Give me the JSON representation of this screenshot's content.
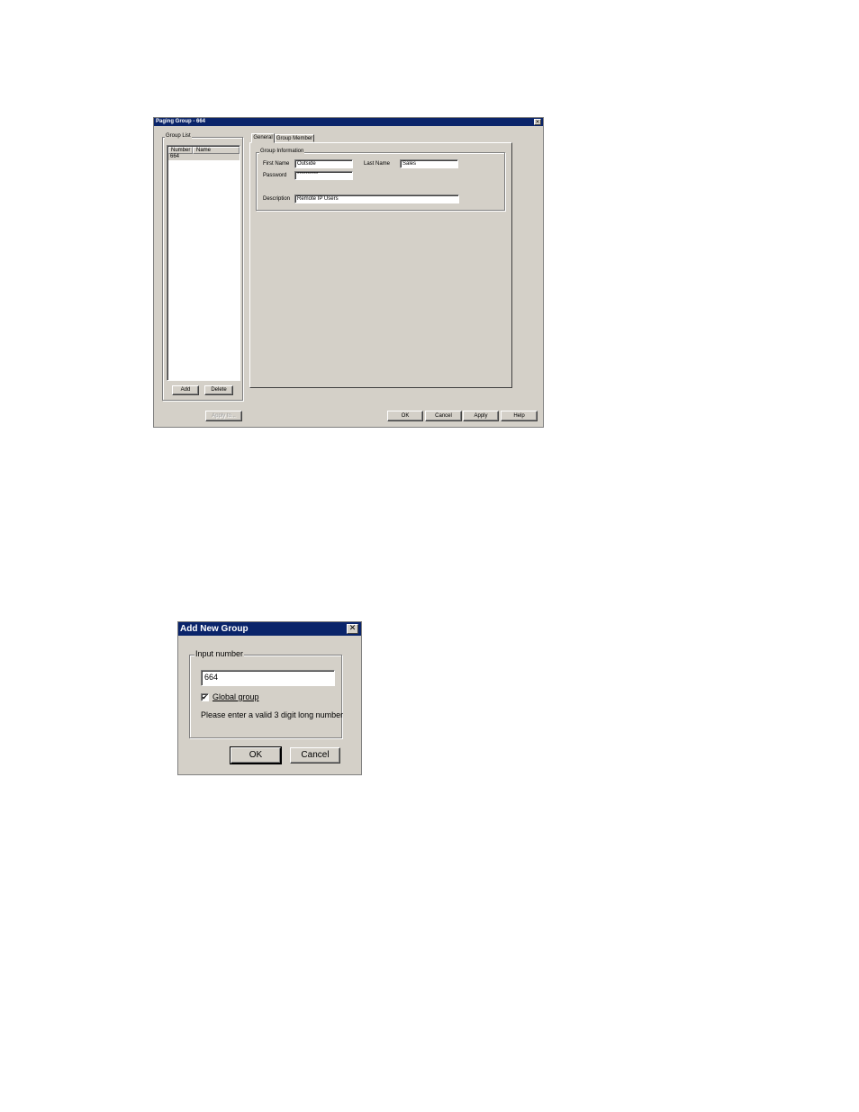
{
  "paging_dialog": {
    "title": "Paging Group - 664",
    "group_list": {
      "legend": "Group List",
      "columns": [
        "Number",
        "Name"
      ],
      "rows": [
        {
          "number": "664",
          "name": ""
        }
      ],
      "add_label": "Add",
      "delete_label": "Delete"
    },
    "tabs": [
      {
        "label": "General",
        "active": true
      },
      {
        "label": "Group Member",
        "active": false
      }
    ],
    "group_info": {
      "legend": "Group Information",
      "first_name_label": "First Name",
      "first_name_value": "Outside",
      "last_name_label": "Last Name",
      "last_name_value": "Sales",
      "password_label": "Password",
      "password_value": "**********",
      "description_label": "Description",
      "description_value": "Remote IP Users"
    },
    "footer": {
      "apply_to_label": "Apply to...",
      "ok_label": "OK",
      "cancel_label": "Cancel",
      "apply_label": "Apply",
      "help_label": "Help"
    }
  },
  "add_dialog": {
    "title": "Add New Group",
    "legend": "Input number",
    "input_value": "664",
    "global_group_label": "Global group",
    "global_group_checked": true,
    "hint": "Please enter a valid 3 digit long number",
    "ok_label": "OK",
    "cancel_label": "Cancel"
  },
  "colors": {
    "title_bar": "#0a246a",
    "dialog_face": "#d4d0c8",
    "list_selection": "#d4d0c8"
  },
  "icons": {
    "close": "close-icon",
    "checkmark": "checkmark-icon"
  }
}
